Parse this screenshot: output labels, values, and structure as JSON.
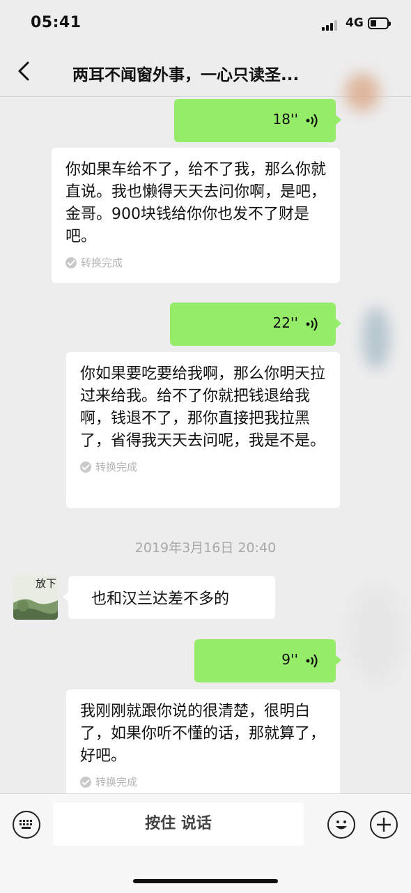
{
  "status": {
    "time": "05:41",
    "network": "4G"
  },
  "header": {
    "title": "两耳不闻窗外事，一心只读圣..."
  },
  "messages": [
    {
      "type": "voice",
      "duration": "18''"
    },
    {
      "type": "transcript",
      "text": "你如果车给不了，给不了我，那么你就直说。我也懒得天天去问你啊，是吧，金哥。900块钱给你你也发不了财是吧。",
      "status": "转换完成"
    },
    {
      "type": "voice",
      "duration": "22''"
    },
    {
      "type": "transcript",
      "text": "你如果要吃要给我啊，那么你明天拉过来给我。给不了你就把钱退给我啊，钱退不了，那你直接把我拉黑了，省得我天天去问呢，我是不是。",
      "status": "转换完成"
    },
    {
      "type": "timestamp",
      "text": "2019年3月16日 20:40"
    },
    {
      "type": "incoming",
      "avatar_text": "放下",
      "text": "也和汉兰达差不多的"
    },
    {
      "type": "voice",
      "duration": "9''"
    },
    {
      "type": "transcript",
      "text": "我刚刚就跟你说的很清楚，很明白了，如果你听不懂的话，那就算了，好吧。",
      "status": "转换完成"
    }
  ],
  "input_bar": {
    "hold_to_talk": "按住 说话"
  },
  "colors": {
    "voice_bubble": "#95ec69",
    "background": "#ededed"
  },
  "icons": [
    "back-arrow-icon",
    "keyboard-icon",
    "emoji-icon",
    "plus-icon",
    "voice-wave-icon",
    "check-icon"
  ]
}
